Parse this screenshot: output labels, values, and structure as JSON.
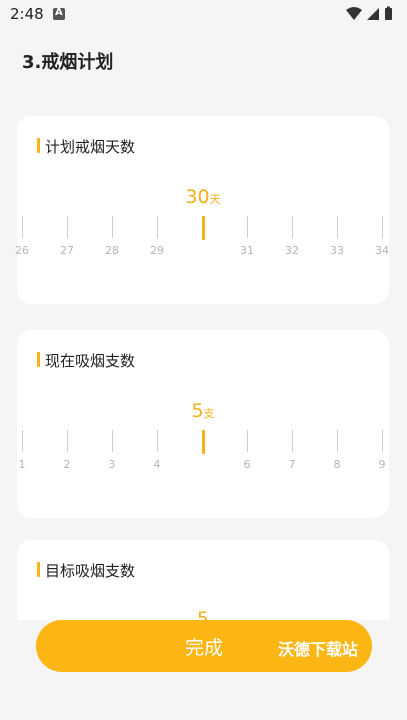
{
  "status_bar": {
    "time": "2:48",
    "a_icon_letter": "A"
  },
  "page_title": "3.戒烟计划",
  "cards": [
    {
      "title": "计划戒烟天数",
      "value": "30",
      "unit": "天",
      "ticks": [
        {
          "label": "26",
          "pos": 0
        },
        {
          "label": "27",
          "pos": 1
        },
        {
          "label": "28",
          "pos": 2
        },
        {
          "label": "29",
          "pos": 3
        },
        {
          "label": "",
          "pos": 4
        },
        {
          "label": "31",
          "pos": 5
        },
        {
          "label": "32",
          "pos": 6
        },
        {
          "label": "33",
          "pos": 7
        },
        {
          "label": "34",
          "pos": 8
        }
      ]
    },
    {
      "title": "现在吸烟支数",
      "value": "5",
      "unit": "支",
      "ticks": [
        {
          "label": "1",
          "pos": 0
        },
        {
          "label": "2",
          "pos": 1
        },
        {
          "label": "3",
          "pos": 2
        },
        {
          "label": "4",
          "pos": 3
        },
        {
          "label": "",
          "pos": 4
        },
        {
          "label": "6",
          "pos": 5
        },
        {
          "label": "7",
          "pos": 6
        },
        {
          "label": "8",
          "pos": 7
        },
        {
          "label": "9",
          "pos": 8
        }
      ]
    },
    {
      "title": "目标吸烟支数",
      "value": "5",
      "unit": "",
      "ticks": []
    }
  ],
  "done_button": {
    "label": "完成"
  },
  "watermark": "沃德下载站",
  "colors": {
    "accent": "#fcb614",
    "background": "#f5f5f5",
    "card": "#ffffff"
  }
}
